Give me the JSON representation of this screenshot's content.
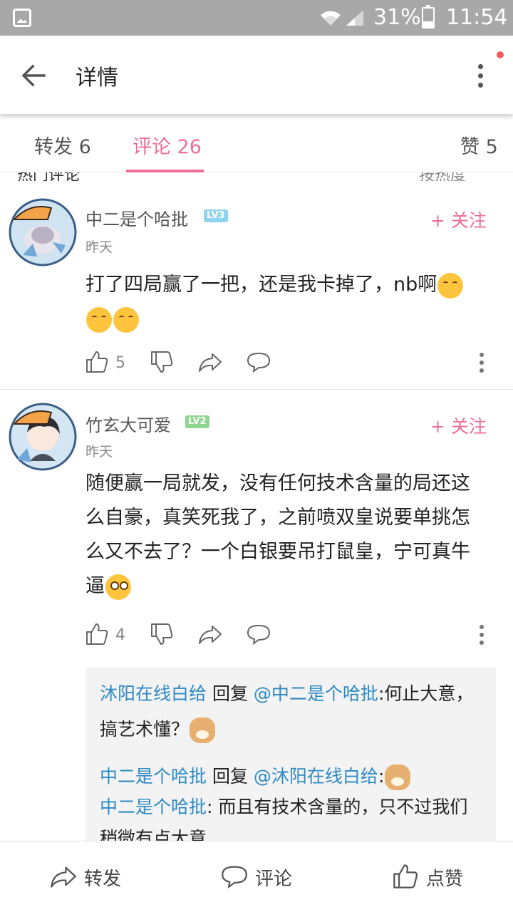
{
  "status_bar": {
    "battery": "31%",
    "time": "11:54",
    "battery_level": 0.31
  },
  "header": {
    "title": "详情"
  },
  "tabs": [
    {
      "label": "转发 6"
    },
    {
      "label": "评论 26"
    },
    {
      "label": "赞 5"
    }
  ],
  "section_peek": {
    "left": "热门评论",
    "right": "按热度"
  },
  "comments": [
    {
      "username": "中二是个哈批",
      "level": "LV3",
      "time": "昨天",
      "follow": "+ 关注",
      "text_1": "打了四局赢了一把，还是我卡掉了，nb啊",
      "likes": "5"
    },
    {
      "username": "竹玄大可爱",
      "level": "LV2",
      "time": "昨天",
      "follow": "+ 关注",
      "text_1": "随便赢一局就发，没有任何技术含量的局还这么自豪，真笑死我了，之前喷双皇说要单挑怎么又不去了？一个白银要吊打鼠皇，宁可真牛逼",
      "likes": "4"
    }
  ],
  "replies": [
    {
      "from": "沐阳在线白给",
      "verb": " 回复 ",
      "to": "@中二是个哈批",
      "text": ":何止大意，搞艺术懂？"
    },
    {
      "from": "中二是个哈批",
      "verb": " 回复 ",
      "to": "@沐阳在线白给",
      "text": ":"
    },
    {
      "from": "中二是个哈批",
      "text": ": 而且有技术含量的，只不过我们稍微有点大意"
    }
  ],
  "bottom_bar": {
    "forward": "转发",
    "comment": "评论",
    "like": "点赞"
  },
  "colors": {
    "accent": "#ee6e96",
    "link": "#2f8ac4",
    "status_bar": "#a8a8a8"
  }
}
